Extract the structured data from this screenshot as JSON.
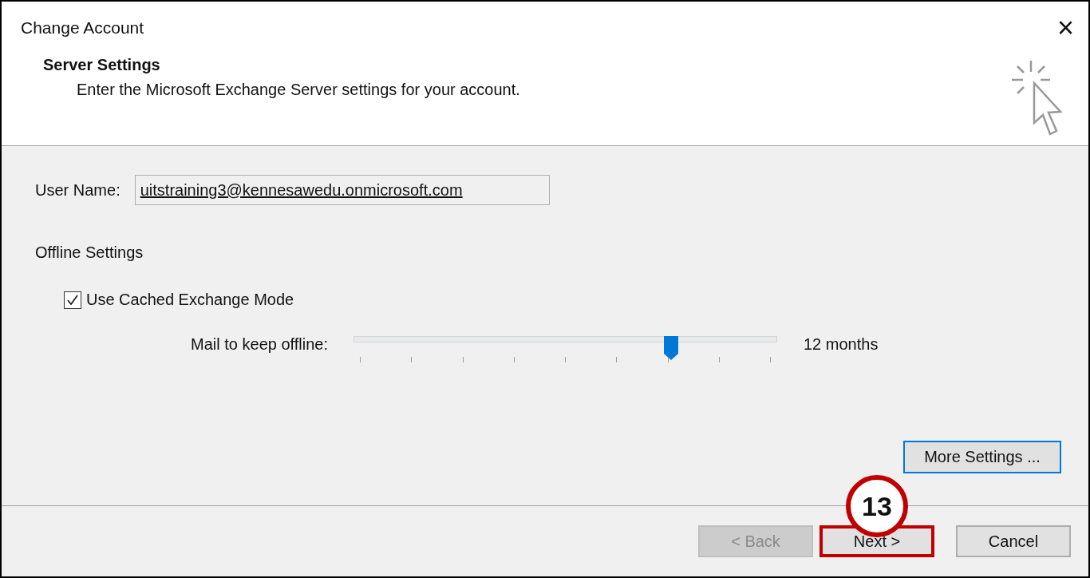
{
  "window": {
    "title": "Change Account",
    "close": "×"
  },
  "header": {
    "heading": "Server Settings",
    "subtitle": "Enter the Microsoft Exchange Server settings for your account."
  },
  "user_name": {
    "label": "User Name:",
    "value": "uitstraining3@kennesawedu.onmicrosoft.com"
  },
  "offline": {
    "heading": "Offline Settings",
    "cached_mode": {
      "label": "Use Cached Exchange Mode",
      "checked": true
    },
    "mail_offline": {
      "label": "Mail to keep offline:",
      "level": 0.75,
      "reading": "12 months"
    }
  },
  "more_settings": {
    "label": "More Settings ...",
    "focused": true
  },
  "buttons": [
    {
      "label": "< Back",
      "disabled": true,
      "highlighted": false
    },
    {
      "label": "Next >",
      "disabled": false,
      "highlighted": true
    },
    {
      "label": "Cancel",
      "disabled": false,
      "highlighted": false
    }
  ],
  "callout": {
    "number": "13"
  }
}
